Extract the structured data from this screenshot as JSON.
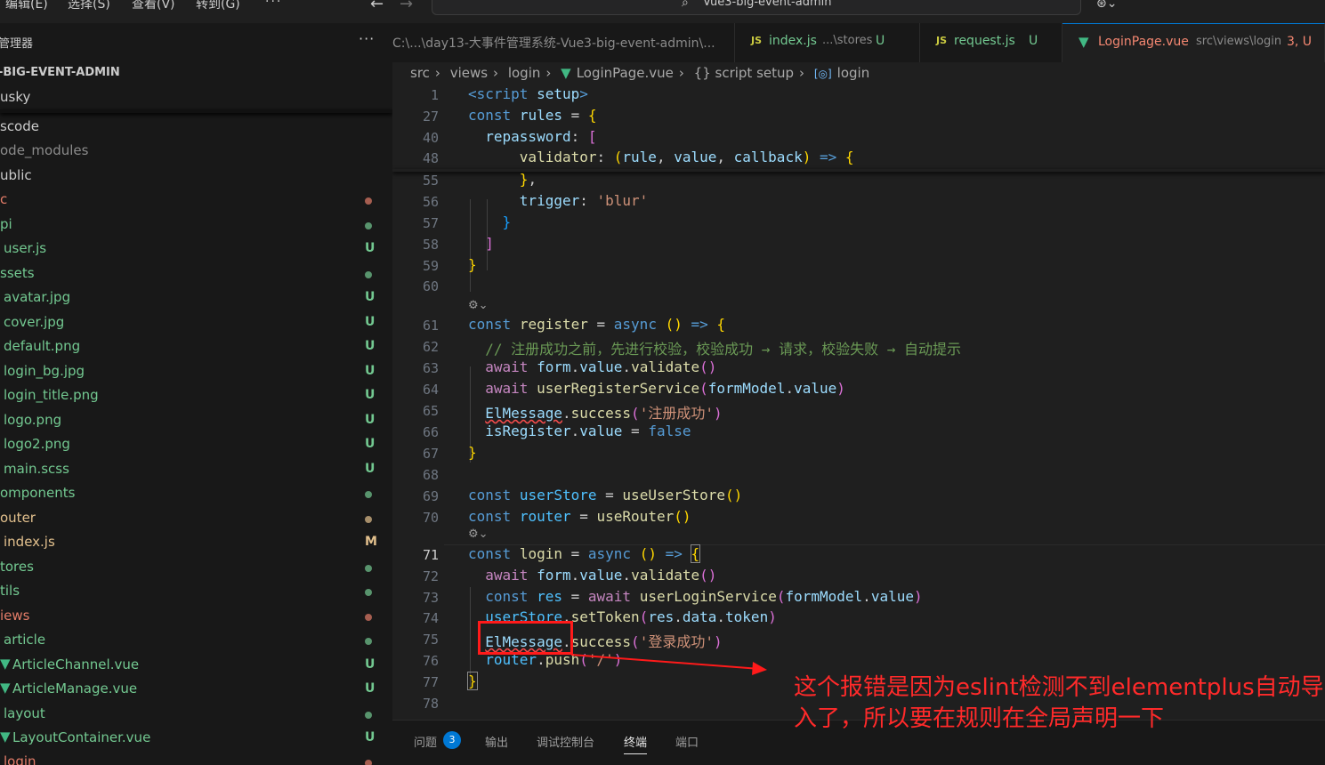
{
  "menu": {
    "items": [
      "编辑(E)",
      "选择(S)",
      "查看(V)",
      "转到(G)",
      "···"
    ]
  },
  "command_center": {
    "label": "Vue3-big-event-admin"
  },
  "sidebar": {
    "title": "管理器",
    "more": "···",
    "project": "-BIG-EVENT-ADMIN",
    "items": [
      {
        "label": "usky",
        "status": "",
        "color": "#cccccc"
      },
      {
        "label": "scode",
        "status": "",
        "color": "#cccccc"
      },
      {
        "label": "ode_modules",
        "status": "",
        "color": "#8b8b8b"
      },
      {
        "label": "ublic",
        "status": "",
        "color": "#cccccc"
      },
      {
        "label": "c",
        "status": "dot",
        "color": "#e37c68"
      },
      {
        "label": "pi",
        "status": "dot",
        "color": "#73c991"
      },
      {
        "label": "user.js",
        "status": "U",
        "color": "#73c991"
      },
      {
        "label": "ssets",
        "status": "dot",
        "color": "#73c991"
      },
      {
        "label": "avatar.jpg",
        "status": "U",
        "color": "#73c991"
      },
      {
        "label": "cover.jpg",
        "status": "U",
        "color": "#73c991"
      },
      {
        "label": "default.png",
        "status": "U",
        "color": "#73c991"
      },
      {
        "label": "login_bg.jpg",
        "status": "U",
        "color": "#73c991"
      },
      {
        "label": "login_title.png",
        "status": "U",
        "color": "#73c991"
      },
      {
        "label": "logo.png",
        "status": "U",
        "color": "#73c991"
      },
      {
        "label": "logo2.png",
        "status": "U",
        "color": "#73c991"
      },
      {
        "label": "main.scss",
        "status": "U",
        "color": "#73c991"
      },
      {
        "label": "omponents",
        "status": "dot",
        "color": "#73c991"
      },
      {
        "label": "outer",
        "status": "dot",
        "color": "#e2c08d"
      },
      {
        "label": "index.js",
        "status": "M",
        "color": "#e2c08d"
      },
      {
        "label": "tores",
        "status": "dot",
        "color": "#73c991"
      },
      {
        "label": "tils",
        "status": "dot",
        "color": "#73c991"
      },
      {
        "label": "iews",
        "status": "dot",
        "color": "#e37c68"
      },
      {
        "label": "article",
        "status": "dot",
        "color": "#73c991"
      },
      {
        "label": "ArticleChannel.vue",
        "status": "U",
        "color": "#73c991"
      },
      {
        "label": "ArticleManage.vue",
        "status": "U",
        "color": "#73c991"
      },
      {
        "label": "layout",
        "status": "dot",
        "color": "#73c991"
      },
      {
        "label": "LayoutContainer.vue",
        "status": "U",
        "color": "#73c991"
      },
      {
        "label": "login",
        "status": "dot",
        "color": "#e37c68"
      }
    ]
  },
  "tabs": [
    {
      "label": "C:\\...\\day13-大事件管理系统-Vue3-big-event-admin\\..."
    },
    {
      "label": "index.js",
      "path": "...\\stores",
      "status": "U"
    },
    {
      "label": "request.js",
      "status": "U"
    },
    {
      "label": "LoginPage.vue",
      "path": "src\\views\\login",
      "status": "3, U"
    }
  ],
  "breadcrumb": [
    "src",
    "views",
    "login",
    "LoginPage.vue",
    "{} script setup",
    "login"
  ],
  "code_lines": {
    "l1": "1",
    "l27": "27",
    "l40": "40",
    "l48": "48",
    "l55": "55",
    "l56": "56",
    "l57": "57",
    "l58": "58",
    "l59": "59",
    "l60": "60",
    "l61": "61",
    "l62": "62",
    "l63": "63",
    "l64": "64",
    "l65": "65",
    "l66": "66",
    "l67": "67",
    "l68": "68",
    "l69": "69",
    "l70": "70",
    "l71": "71",
    "l72": "72",
    "l73": "73",
    "l74": "74",
    "l75": "75",
    "l76": "76",
    "l77": "77",
    "l78": "78"
  },
  "panel": {
    "problems": "问题",
    "problems_count": "3",
    "output": "输出",
    "debug_console": "调试控制台",
    "terminal": "终端",
    "ports": "端口"
  },
  "annotation": {
    "text": "这个报错是因为eslint检测不到elementplus自动导入了，所以要在规则在全局声明一下",
    "color": "#ff2a2a"
  }
}
